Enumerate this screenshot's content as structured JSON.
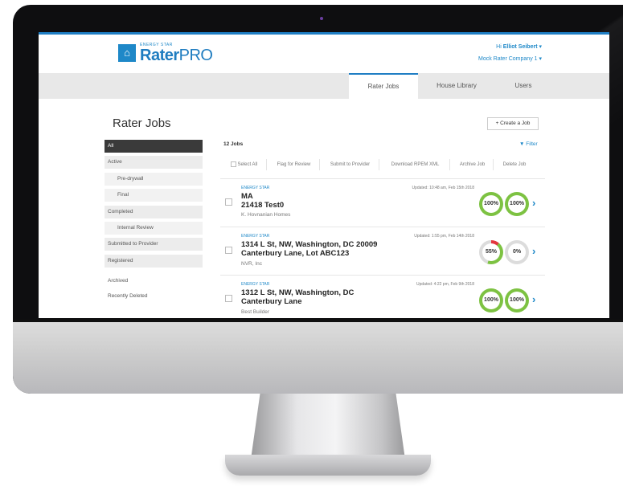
{
  "header": {
    "logo_small": "ENERGY STAR",
    "logo_main": "Rater",
    "logo_pro": "PRO",
    "greeting_prefix": "Hi",
    "user_name": "Elliot Seibert",
    "company": "Mock Rater Company 1"
  },
  "nav": {
    "tabs": [
      {
        "label": "Rater Jobs"
      },
      {
        "label": "House Library"
      },
      {
        "label": "Users"
      }
    ]
  },
  "page": {
    "title": "Rater Jobs",
    "create_label": "+ Create a Job"
  },
  "sidebar": {
    "items": [
      {
        "label": "All"
      },
      {
        "label": "Active"
      },
      {
        "label": "Pre-drywall"
      },
      {
        "label": "Final"
      },
      {
        "label": "Completed"
      },
      {
        "label": "Internal Review"
      },
      {
        "label": "Submitted to Provider"
      },
      {
        "label": "Registered"
      }
    ],
    "archived": "Archived",
    "recently_deleted": "Recently Deleted"
  },
  "jobs": {
    "count": "12 Jobs",
    "filter_label": "Filter",
    "toolbar": [
      "Select All",
      "Flag for Review",
      "Submit to Provider",
      "Download RPEM XML",
      "Archive Job",
      "Delete Job"
    ],
    "rows": [
      {
        "program": "ENERGY STAR",
        "updated": "Updated: 10:48 am, Feb 15th 2018",
        "addr1": "MA",
        "addr2": "21418 Test0",
        "builder": "K. Hovnanian Homes",
        "gauge1": "100%",
        "gauge2": "100%",
        "gauge1_level": 1.0,
        "gauge2_level": 1.0
      },
      {
        "program": "ENERGY STAR",
        "updated": "Updated: 1:55 pm, Feb 14th 2018",
        "addr1": "1314 L St, NW, Washington, DC 20009",
        "addr2": "Canterbury Lane, Lot ABC123",
        "builder": "NVR, Inc",
        "gauge1": "55%",
        "gauge2": "0%",
        "gauge1_level": 0.55,
        "gauge2_level": 0.0
      },
      {
        "program": "ENERGY STAR",
        "updated": "Updated: 4:22 pm, Feb 9th 2018",
        "addr1": "1312 L St, NW, Washington, DC",
        "addr2": "Canterbury Lane",
        "builder": "Best Builder",
        "gauge1": "100%",
        "gauge2": "100%",
        "gauge1_level": 1.0,
        "gauge2_level": 1.0
      }
    ]
  },
  "colors": {
    "accent_blue": "#1e88c8",
    "gauge_green": "#7dc242",
    "gauge_red": "#e2363e",
    "gauge_empty": "#dcdcdc"
  }
}
